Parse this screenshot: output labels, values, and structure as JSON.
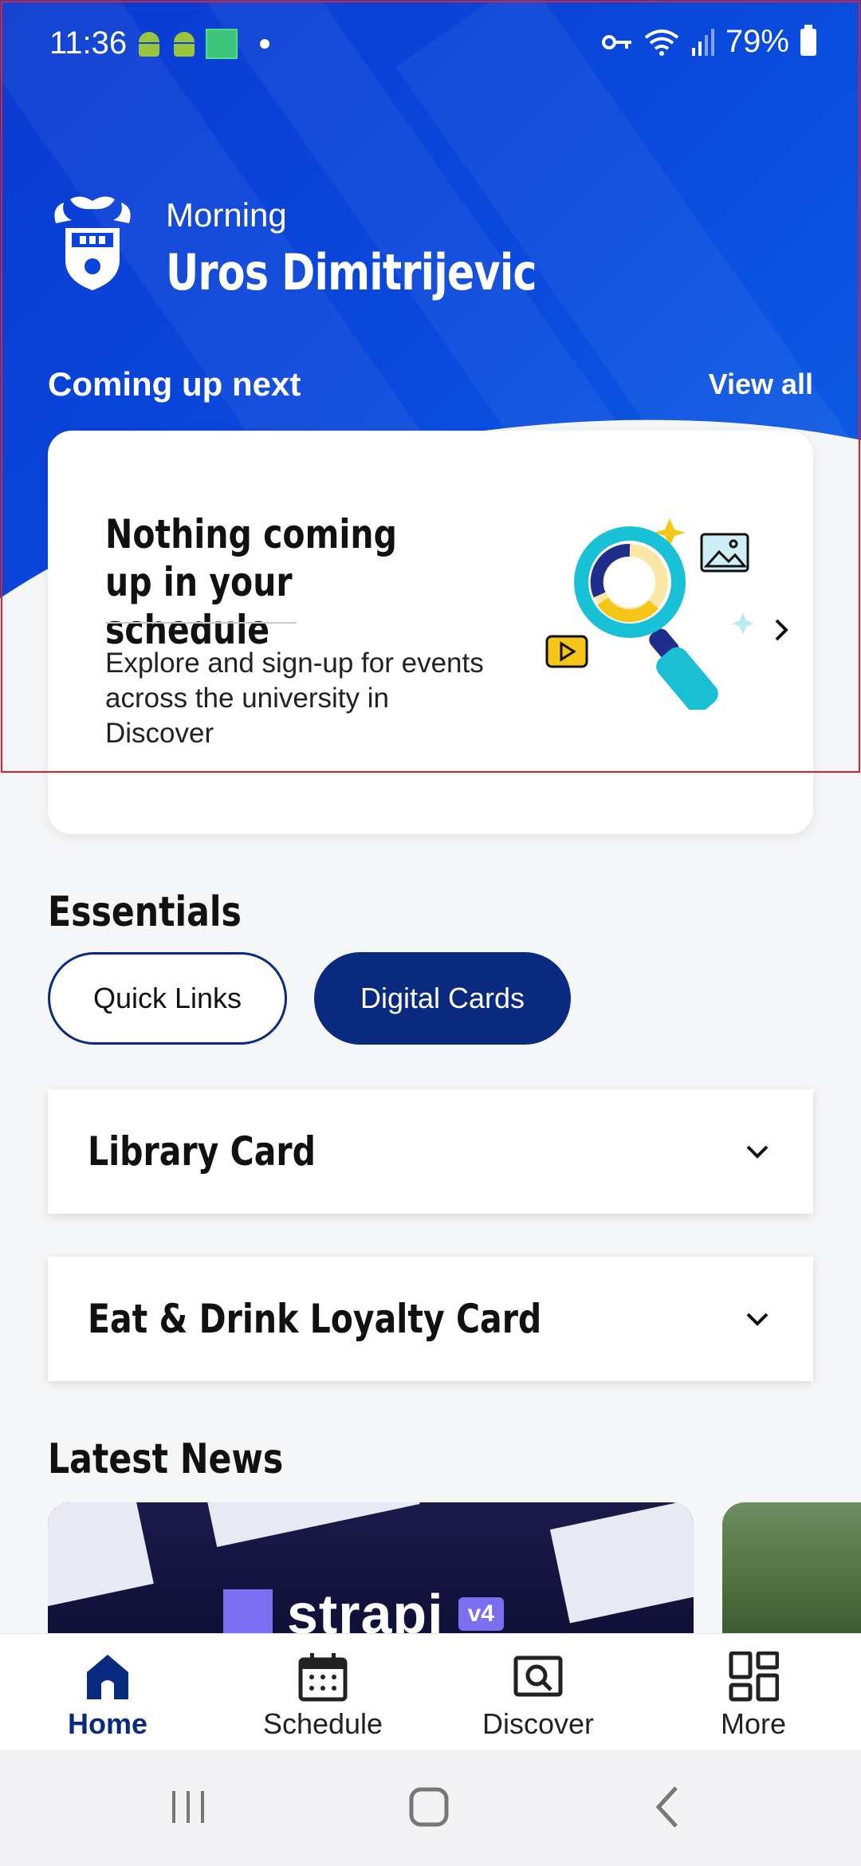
{
  "status_bar": {
    "time": "11:36",
    "battery": "79%"
  },
  "header": {
    "greeting": "Morning",
    "user_name": "Uros Dimitrijevic"
  },
  "coming_up": {
    "title": "Coming up next",
    "view_all": "View all",
    "card": {
      "title": "Nothing coming up in your schedule",
      "body": "Explore and sign-up for events across the university in Discover"
    }
  },
  "essentials": {
    "title": "Essentials",
    "tabs": [
      {
        "label": "Quick Links",
        "selected": false
      },
      {
        "label": "Digital Cards",
        "selected": true
      }
    ],
    "cards": [
      {
        "label": "Library Card"
      },
      {
        "label": "Eat & Drink Loyalty Card"
      }
    ]
  },
  "news": {
    "title": "Latest News",
    "items": [
      {
        "logo_text": "strapi",
        "badge": "v4"
      }
    ]
  },
  "bottom_nav": {
    "items": [
      {
        "label": "Home",
        "icon": "home-icon",
        "active": true
      },
      {
        "label": "Schedule",
        "icon": "calendar-icon",
        "active": false
      },
      {
        "label": "Discover",
        "icon": "discover-icon",
        "active": false
      },
      {
        "label": "More",
        "icon": "grid-icon",
        "active": false
      }
    ]
  },
  "colors": {
    "hero_blue": "#0a48dc",
    "navy": "#0a2a80",
    "background": "#f5f6f8"
  }
}
